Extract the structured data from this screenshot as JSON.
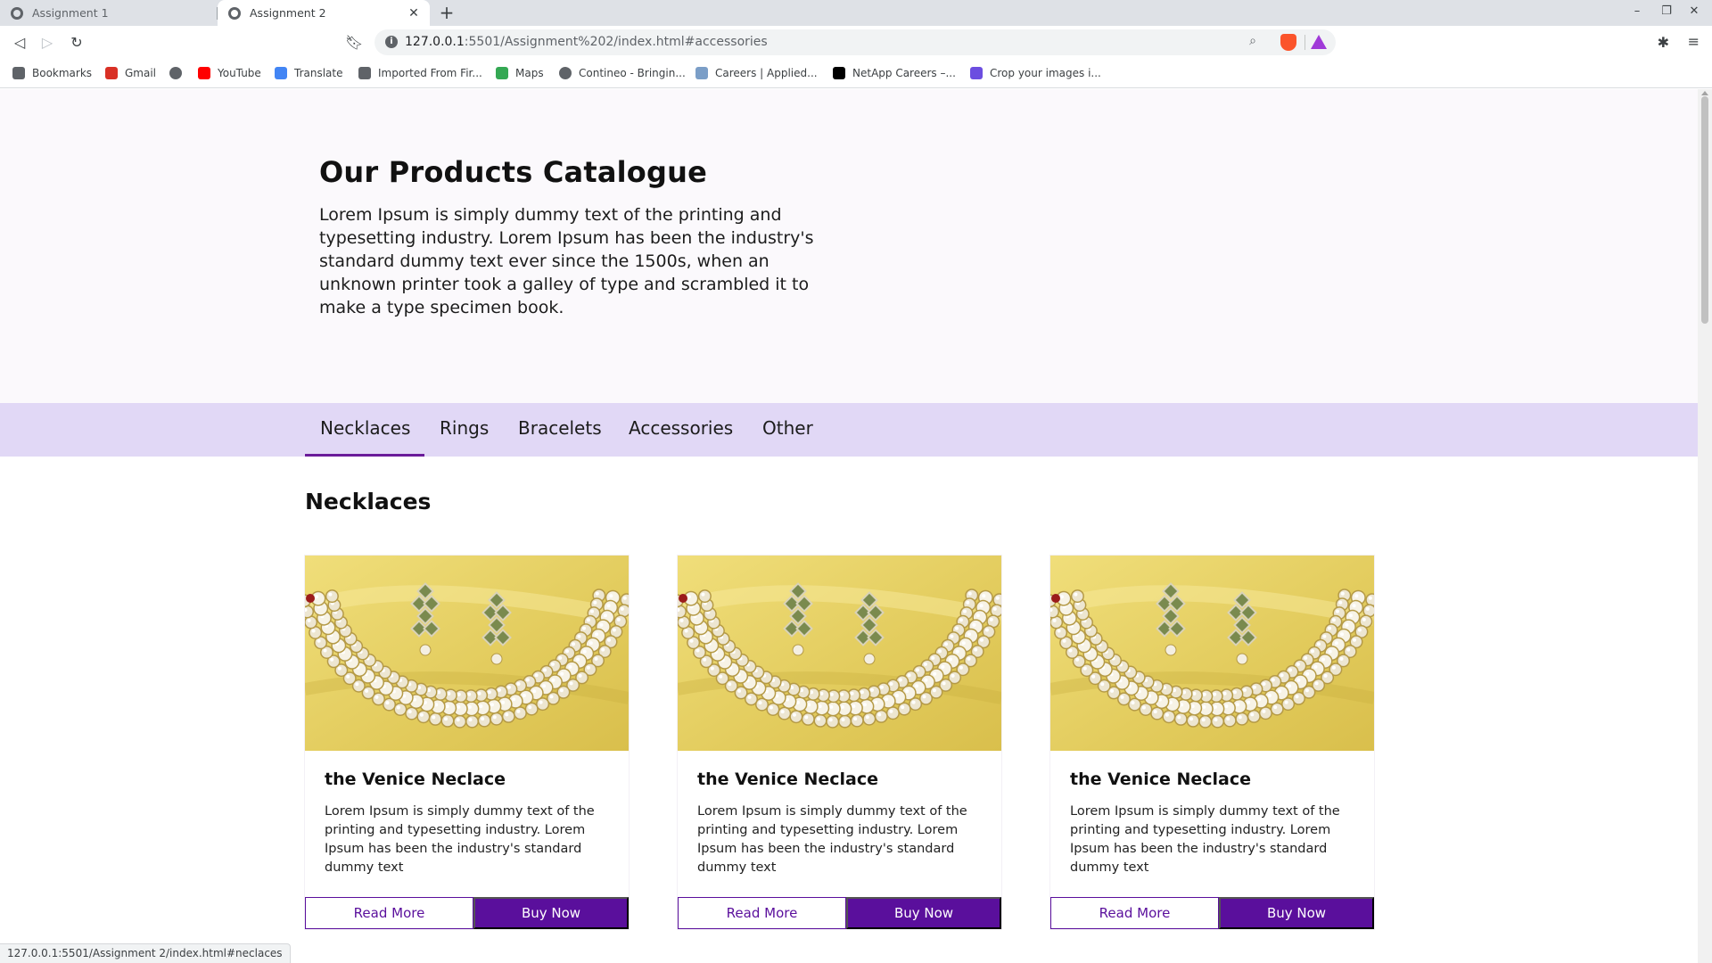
{
  "browser": {
    "tabs": [
      {
        "title": "Assignment 1"
      },
      {
        "title": "Assignment 2"
      }
    ],
    "new_tab_symbol": "+",
    "close_symbol": "✕",
    "url_host": "127.0.0.1",
    "url_rest": ":5501/Assignment%202/index.html#accessories",
    "bookmarks": [
      {
        "label": "Bookmarks",
        "icon": "bookmarks-icon",
        "color": "#5f6368"
      },
      {
        "label": "Gmail",
        "icon": "gmail-icon",
        "color": "#d93025"
      },
      {
        "label": "",
        "icon": "globe-icon",
        "color": "#5f6368"
      },
      {
        "label": "YouTube",
        "icon": "youtube-icon",
        "color": "#ff0000"
      },
      {
        "label": "Translate",
        "icon": "translate-icon",
        "color": "#4285f4"
      },
      {
        "label": "Imported From Fir...",
        "icon": "folder-icon",
        "color": "#5f6368"
      },
      {
        "label": "Maps",
        "icon": "maps-icon",
        "color": "#34a853"
      },
      {
        "label": "Contineo - Bringin...",
        "icon": "globe-icon",
        "color": "#5f6368"
      },
      {
        "label": "Careers | Applied...",
        "icon": "careers-icon",
        "color": "#7b9ec7"
      },
      {
        "label": "NetApp Careers –...",
        "icon": "netapp-icon",
        "color": "#000000"
      },
      {
        "label": "Crop your images i...",
        "icon": "heart-icon",
        "color": "#6c4ee0"
      }
    ],
    "status_url": "127.0.0.1:5501/Assignment 2/index.html#neclaces"
  },
  "hero": {
    "title": "Our Products Catalogue",
    "description": "Lorem Ipsum is simply dummy text of the printing and typesetting industry. Lorem Ipsum has been the industry's standard dummy text ever since the 1500s, when an unknown printer took a galley of type and scrambled it to make a type specimen book."
  },
  "categories": [
    "Necklaces",
    "Rings",
    "Bracelets",
    "Accessories",
    "Other"
  ],
  "active_category": "Necklaces",
  "section": {
    "title": "Necklaces"
  },
  "products": [
    {
      "name": "the Venice Neclace",
      "description": "Lorem Ipsum is simply dummy text of the printing and typesetting industry. Lorem Ipsum has been the industry's standard dummy text",
      "read_more": "Read More",
      "buy_now": "Buy Now"
    },
    {
      "name": "the Venice Neclace",
      "description": "Lorem Ipsum is simply dummy text of the printing and typesetting industry. Lorem Ipsum has been the industry's standard dummy text",
      "read_more": "Read More",
      "buy_now": "Buy Now"
    },
    {
      "name": "the Venice Neclace",
      "description": "Lorem Ipsum is simply dummy text of the printing and typesetting industry. Lorem Ipsum has been the industry's standard dummy text",
      "read_more": "Read More",
      "buy_now": "Buy Now"
    }
  ],
  "colors": {
    "accent": "#5a0f9c",
    "nav_background": "#e1d8f6",
    "hero_background": "#fbf9fc"
  }
}
